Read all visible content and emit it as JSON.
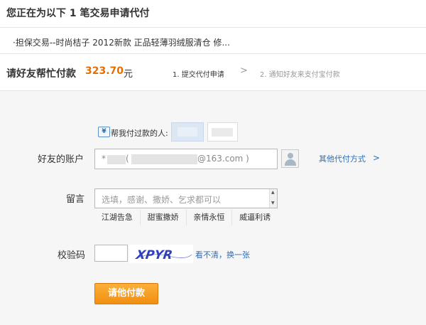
{
  "header": {
    "title": "您正在为以下 1 笔交易申请代付"
  },
  "item": {
    "text": "·担保交易--时尚桔子 2012新款 正品轻薄羽绒服清仓 修..."
  },
  "amount": {
    "label": "请好友帮忙付款",
    "value": "323.70",
    "unit": "元"
  },
  "steps": [
    {
      "label": "1. 提交代付申请",
      "active": true
    },
    {
      "label": "2. 通知好友来支付宝付款",
      "active": false
    }
  ],
  "step_separator": ">",
  "recent_payers": {
    "icon": "recent-payer-icon",
    "icon_glyph": "¥",
    "label": "帮我付过款的人:"
  },
  "account": {
    "label": "好友的账户",
    "prefix": "*",
    "paren": "(",
    "domain_suffix": "@163.com )",
    "contact_icon": "contacts-icon",
    "other_methods": "其他代付方式",
    "other_methods_arrow": ">"
  },
  "message": {
    "label": "留言",
    "placeholder": "选填，感谢、撒娇、乞求都可以",
    "quick_phrases": [
      "江湖告急",
      "甜蜜撒娇",
      "亲情永恒",
      "威逼利诱"
    ]
  },
  "captcha": {
    "label": "校验码",
    "image_text": "XPYR",
    "refresh": "看不清，换一张"
  },
  "submit": {
    "label": "请他付款"
  },
  "colors": {
    "accent": "#e37000",
    "link": "#2c6eb5",
    "button": "#f3991f"
  }
}
